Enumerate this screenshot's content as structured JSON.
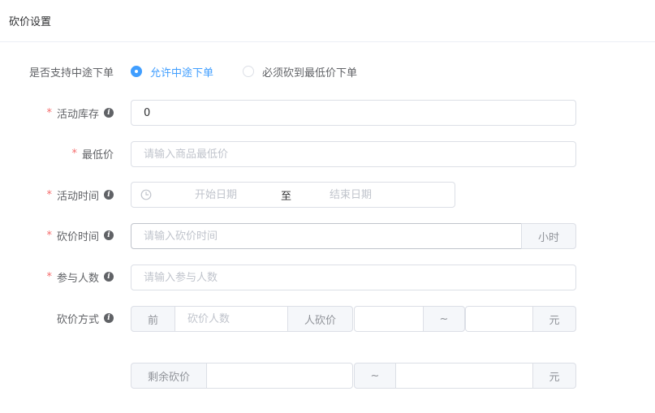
{
  "header": {
    "title": "砍价设置"
  },
  "form": {
    "midway": {
      "label": "是否支持中途下单",
      "options": [
        {
          "label": "允许中途下单",
          "checked": true
        },
        {
          "label": "必须砍到最低价下单",
          "checked": false
        }
      ]
    },
    "stock": {
      "label": "活动库存",
      "required_mark": "*",
      "value": "0",
      "info_glyph": "i"
    },
    "min_price": {
      "label": "最低价",
      "required_mark": "*",
      "placeholder": "请输入商品最低价"
    },
    "activity_time": {
      "label": "活动时间",
      "required_mark": "*",
      "info_glyph": "i",
      "start_placeholder": "开始日期",
      "separator": "至",
      "end_placeholder": "结束日期"
    },
    "bargain_time": {
      "label": "砍价时间",
      "required_mark": "*",
      "info_glyph": "i",
      "placeholder": "请输入砍价时间",
      "suffix": "小时"
    },
    "participants": {
      "label": "参与人数",
      "required_mark": "*",
      "info_glyph": "i",
      "placeholder": "请输入参与人数"
    },
    "bargain_method": {
      "label": "砍价方式",
      "info_glyph": "i",
      "row1": {
        "prefix": "前",
        "count_placeholder": "砍价人数",
        "mid_label": "人砍价",
        "min_value": "",
        "tilde": "~",
        "max_value": "",
        "unit": "元"
      },
      "row2": {
        "prefix": "剩余砍价",
        "min_value": "",
        "tilde": "~",
        "max_value": "",
        "unit": "元"
      }
    }
  },
  "colors": {
    "primary": "#409eff",
    "required": "#f56c6c",
    "border": "#dcdfe6",
    "addon_bg": "#f5f7fa"
  }
}
